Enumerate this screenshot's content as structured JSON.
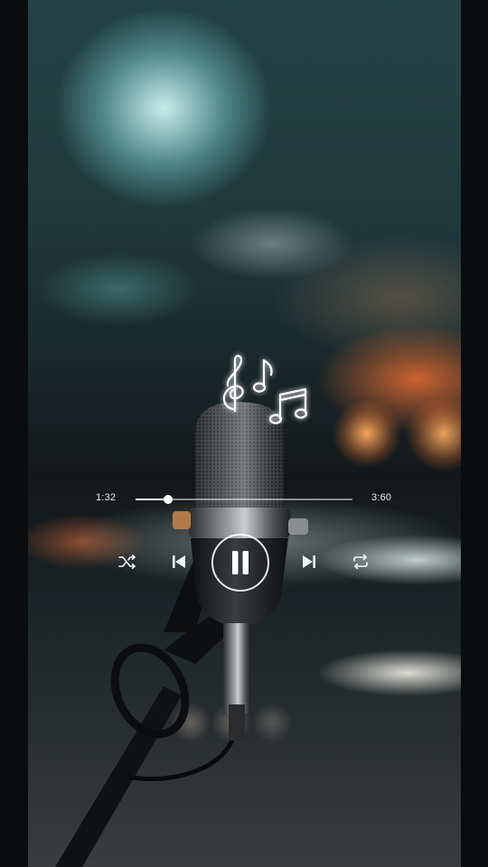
{
  "player": {
    "current_time": "1:32",
    "total_time": "3:60",
    "progress": 0.15,
    "state": "playing"
  },
  "controls": {
    "shuffle": "shuffle-icon",
    "previous": "skip-back-icon",
    "play_pause": "pause-icon",
    "next": "skip-forward-icon",
    "repeat": "repeat-icon"
  },
  "theme": {
    "overlay_color": "#ffffff",
    "glow_color": "#ffffff"
  }
}
